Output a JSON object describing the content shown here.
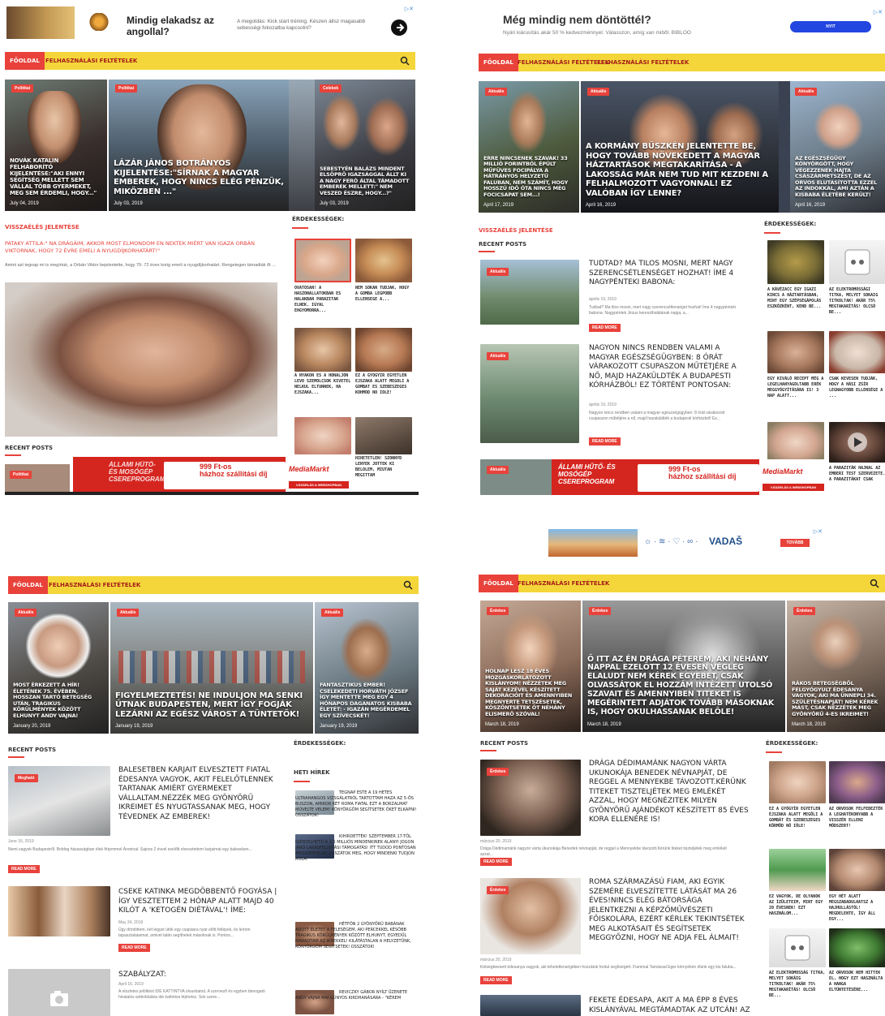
{
  "colors": {
    "accent": "#e8423b",
    "nav": "#f4d63a",
    "nav_link": "#a51a1a"
  },
  "p1": {
    "ad": {
      "title": "Mindig elakadsz az angollal?",
      "desc": "A megoldás: Kick start tréning. Készen állsz magasabb sebességi fokozatba kapcsolni?"
    },
    "nav": {
      "home": "FŐOLDAL",
      "link1": "FELHASZNÁLÁSI FELTÉTELEK"
    },
    "heroes": [
      {
        "badge": "Politikai",
        "title": "Novák Katalin felháborító kijelentése:\"Aki ennyi segítség mellett sem vállal több gyermeket, meg sem érdemli, hogy...\"",
        "date": "July 04, 2019"
      },
      {
        "badge": "Politikai",
        "title": "LÁZÁR JÁNOS BOTRÁNYOS KIJELENTÉSE:\"Sírnak a magyar emberek, hogy nincs elég pénzük, miközben ...\"",
        "date": "July 03, 2019"
      },
      {
        "badge": "Celebek",
        "title": "Sebestyén Balázs mindent elsöprő igazsággal állt ki a nagy Feró által támadott emberek mellett:\" Nem veszed észre, hogy...?\"",
        "date": "July 03, 2019"
      }
    ],
    "section": "VISSZAÉLÉS JELENTÉSE",
    "article": {
      "title": "PATAKY ATTILA:\" NA DRÁGÁIM, AKKOR MOST ELMONDOM EN NEKTEK MIÉRT VAN IGAZA ORBÁN VIKTORNAK, HOGY 72 ÉVRE EMELI A NYUGDÍJKORHATÁRT!\"",
      "excerpt": "Amint azt tegnap mi is megírtuk, a Orbán Viktor bejelentette, hogy 70- 72 éves korig emeli a nyugdíjkorhatárt. Rengetegen támadták őt ..."
    },
    "recent": "RECENT POSTS",
    "recent_badge": "Politikai",
    "side_title": "ÉRDEKESSÉGEK:",
    "side": [
      "OVATOSAN! A HASZONALLATOKBAN ES HALAKBAN PARAZITAK ELNEK. IGYAL EHGYOMORRA...",
      "NEM SOKAN TUDJAK, HOGY A GOMBA LEGPOBB ELLENSEGE A...",
      "A NYAKON ES A HONALJON LEVO SZEMOLCSOK KIVETEL NELKUL ELTUNNEK, HA EJSZAKA...",
      "EZ A GYOGYIR EGYETLEN EJSZAKA ALATT MEGOLI A GOMBAT ES SZEBESZEGES KOHMOD NO IOLE!",
      "",
      "HIHETETLEN! SZONNYD LENYEK JOTTEK KI BELOLEM, MIUTAN MEGITTAM"
    ],
    "banner": {
      "left": "ÁLLAMI HŰTŐ- ÉS MOSÓGÉP CSEREPROGRAM",
      "price": "999 Ft-os",
      "sub": "házhoz szállítási díj",
      "brand": "MediaMarkt",
      "cta": "VÁSÁRLÁS A WEBSHOPBAN"
    }
  },
  "p2": {
    "ad": {
      "title": "Még mindig nem döntöttél?",
      "desc": "Nyári kiárusítás akár 50 % kedvezménnyel. Válasszon, amíg van miből. BIBLOO",
      "btn": "NYIT"
    },
    "nav": {
      "home": "FŐOLDAL",
      "link1": "FELHASZNÁLÁSI FELTÉTELEK",
      "link2": "FELHASZNÁLÁSI FELTÉTELEK"
    },
    "heroes": [
      {
        "badge": "Aktuális",
        "title": "Erre nincsenek szavak! 33 millió forintból épült műfüves focipálya a hátrányos helyzetű faluban, nem számít, hogy hosszú idő óta nincs még focicsapat sem...!",
        "date": "April 17, 2019"
      },
      {
        "badge": "Aktuális",
        "title": "A KORMÁNY BÜSZKÉN JELENTETTE BE, HOGY TOVÁBB NÖVEKEDETT A MAGYAR HÁZTARTÁSOK MEGTAKARÍTÁSA - A LAKOSSÁG MÁR NEM TUD MIT KEZDENI A FELHALMOZOTT VAGYONNAL! EZ VALÓBAN ÍGY LENNE?",
        "date": "April 16, 2019"
      },
      {
        "badge": "Aktuális",
        "title": "Az egészségügy könyörgött, hogy végezzenek hajta császármetszést, de az orvos elutasította ezzel az indokkal, ami aztán a kisbaba életébe került!",
        "date": "April 16, 2019"
      }
    ],
    "section": "VISSZAÉLÉS JELENTÉSE",
    "recent": "RECENT POSTS",
    "posts": [
      {
        "badge": "Aktuális",
        "title": "TUDTAD? MA TILOS MOSNI, MERT NAGY SZERENCSÉTLENSÉGET HOZHAT! ÍME 4 NAGYPÉNTEKI BABONA:",
        "date": "április 19, 2019",
        "excerpt": "Tudtad? Ma tilos mosni, mert nagy szerencsétlenséget hozhat! Íme 4 nagypénteki babona: Nagypéntek Jézus kereszthalálának napja, a...",
        "more": "READ MORE"
      },
      {
        "badge": "Aktuális",
        "title": "NAGYON NINCS RENDBEN VALAMI A MAGYAR EGÉSZSÉGÜGYBEN: 8 ÓRÁT VÁRAKOZOTT CSUPASZON MŰTÉTJÉRE A NŐ, MAJD HAZAKÜLDTÉK A BUDAPESTI KÓRHÁZBÓL! EZ TÖRTÉNT PONTOSAN:",
        "date": "április 19, 2019",
        "excerpt": "Nagyon nincs rendben valami a magyar egészségügyben: 8 órát várakozott csupaszon műtétjére a nő, majd hazaküldték a budapesti kórházból! Ez...",
        "more": "READ MORE"
      }
    ],
    "recent_badge": "Aktuális",
    "side_title": "ÉRDEKESSÉGEK:",
    "side": [
      "A KÁVÉZACC EGY IGAZI KINCS A HÁZTARTÁSBAN, MINT EGY SZÉPSÉGÁPOLÁS ESZKÖZKÉNT, KEND BE...",
      "AZ ELEKTROMOSSÁGI TITKA, MELYET SOKAIG TITKOLTAK! AKÁR 75% MEGTAKARÍTÁS! OLCSÓ BE...",
      "EGY KIVÁLÓ RECEPT MÉG A LEGELHANYAGOLTABB ERÉK MEGGYÓGYÍTÁSÁRA IS! 3 NAP ALATT...",
      "CSAK KEVESEN TUDJÁK, HOGY A HÁSI ZSÍR LEGNAGYOBB ELLENSÉGE A ...",
      "",
      "A PARAZITÁK HAJNAL AZ EMBERI TEST SZERVEZETE. A PARAZITÁKAT CSAK"
    ],
    "banner": {
      "left": "ÁLLAMI HŰTŐ- ÉS MOSÓGÉP CSEREPROGRAM",
      "price": "999 Ft-os",
      "sub": "házhoz szállítási díj",
      "brand": "MediaMarkt",
      "cta": "VÁSÁRLÁS A WEBSHOPBAN"
    }
  },
  "p3": {
    "nav": {
      "home": "FŐOLDAL",
      "link1": "FELHASZNÁLÁSI FELTÉTELEK"
    },
    "heroes": [
      {
        "badge": "Aktuális",
        "title": "Most érkezett a hír! Életének 75. évében, hosszan tartó betegség után, tragikus körülmények között elhunyt Andy Vajna!",
        "date": "January 20, 2019"
      },
      {
        "badge": "Aktuális",
        "title": "FIGYELMEZTETÉS! NE INDULJON MA SENKI ÚTNAK BUDAPESTEN, MERT ÍGY FOGJÁK LEZÁRNI AZ EGÉSZ VÁROST A TÜNTETŐK!",
        "date": "January 19, 2019"
      },
      {
        "badge": "Aktuális",
        "title": "Fantasztikus ember! Cselekedeti Horváth József így mentette meg egy 4 hónapos daganatos kisbaba életét: - Igazán megérdemel egy szívecskét!",
        "date": "January 19, 2019"
      }
    ],
    "recent": "RECENT POSTS",
    "posts": [
      {
        "badge": "Megható",
        "title": "BALESETBEN KARJAIT ELVESZTETT FIATAL ÉDESANYA VAGYOK, AKIT FELELŐTLENNEK TARTANAK AMIÉRT GYERMEKET VÁLLALTAM.NÉZZÉK MEG GYÖNYÖRŰ IKREIMET ÉS NYUGTASSANAK MEG, HOGY TÉVEDNEK AZ EMBEREK!",
        "date": "June 16, 2019",
        "excerpt": "Nemi vagyok Budapestről. Boldog házasságban élek férjemmel Ároninal. Sajnos 2 évvel ezelőtt elvesztettem karjaimat egy baleseben...",
        "more": "READ MORE"
      },
      {
        "badge": "",
        "title": "CSEKE KATINKA MEGDÖBBENTŐ FOGYÁSA | ÍGY VESZTETTEM 2 HÓNAP ALATT MAJD 40 KILÓT A 'KETOGÉN DIÉTÁVAL'! ÍME:",
        "date": "May 24, 2019",
        "excerpt": "Úgy döntöttem, két legyet ütök egy csapásra nyár előtt fellépek, és leírom tapasztalataimat, amivel talán segíthetek másoknak is. Pontos...",
        "more": "READ MORE"
      },
      {
        "badge": "",
        "title": "SZABÁLYZAT:",
        "date": "April 16, 2019",
        "excerpt": "A részletes jelölkést IDE KATTINTVA olvashatod. A szervező és egyben támogató hivatalos weboldalára ide kattintva léphetsz. Sok szere...",
        "more": ""
      }
    ],
    "side_title": "ÉRDEKESSÉGEK:",
    "weekly": "HETI HÍREK",
    "news": [
      "TEGNAP ESTE A 19 HETES ULTRAHANGOS VIZSGÁLATRÓL TARTOTTAM HAZA AZ 5-ÖS BUSZON, AMIKOR KÉT ROMA FIATAL EZT A BORZALMAT MŰVELTE VELEM! KÖNYÖRGÖM SEGÍTSETEK ŐKET ELKAPNI! OSSZÁTOK!",
      "KIHIRDETTÉK! SZEPTEMBER 17-TŐL IGÉNYELHETŐ A 2,5 MILLIÓS MINDENKINEK ALANYI JOGON JÁRÓ LAKÁSFELÚJÍTÁSI TÁMOGATÁS! ITT TUDOD PONTOSAN MEGIGÉNYELNI! OSSZÁTOK MEG, HOGY MINDENKI TUDJON RÓLA!",
      "HÉTFŐN 2 GYÖNYÖRŰ BABÁNAK ADOTT ÉLETET A FELESÉGEM, AKI PERCEKKEL KÉSŐBB TRAGIKUS KÖRÜLMÉNYEK KÖZÖTT ELHUNYT, EGYEDÜL MARADTAM AZ IKREKKEL! KILÁTÁSTALAN A HELYZETÜNK, KÖNYÖRGÖM SEGÍTSETEK! OSSZÁTOK!",
      "REVICZKY GÁBOR NYÍLT ÜZENETE ANDY VAJNA MAI GÚNYOS KIRDHANÁSÁRA - \"KÉREM"
    ]
  },
  "p4": {
    "ad": {
      "brand": "VADAŠ",
      "btn": "TOVÁBB"
    },
    "nav": {
      "home": "FŐOLDAL",
      "link1": "FELHASZNÁLÁSI FELTÉTELEK"
    },
    "heroes": [
      {
        "badge": "Érdekes",
        "title": "Holnap lesz 18 éves mozgáskorlátozott kislányom! Nézzétek meg saját kezével készített dekorációit és amennyiben megnyerte tetszésetek, köszöntsétek őt néhány elismerő szóval!",
        "date": "March 18, 2019"
      },
      {
        "badge": "Érdekes",
        "title": "Ő itt az én drága péterem, aki néhány nappal ezelőtt 12 évesen végleg elaludt nem kérek egyebet, csak olvassátok el hozzám intézett utolsó szavait és amennyiben titeket is megérintett adjátok tovább másoknak is, hogy okulhassanak belőle!",
        "date": "March 18, 2019"
      },
      {
        "badge": "Érdekes",
        "title": "Rákos betegségből felgyógyult édesanya vagyok, aki ma ünnepli 34. születésnapját! Nem kérek mást, csak nézzétek meg gyönyörű 4-es ikreimet!",
        "date": "March 18, 2019"
      }
    ],
    "recent": "RECENT POSTS",
    "posts": [
      {
        "badge": "Érdekes",
        "title": "DRÁGA DÉDIMAMÁNK NAGYON VÁRTA UKUNOKÁJA BENEDEK NÉVNAPJÁT, DE REGGEL A MENNYEKBE TÁVOZOTT.KÉRÜNK TITEKET TISZTELJÉTEK MEG EMLÉKÉT AZZAL, HOGY MEGNÉZITEK MILYEN GYÖNYÖRŰ AJÁNDÉKOT KÉSZÍTETT 85 ÉVES KORA ELLENÉRE IS!",
        "date": "március 20, 2019",
        "excerpt": "Drága Dédimamánk nagyon várta ükunokája Benedek névnapját, de reggel a Mennyekbe távozott.Kérünk titeket tiszteljétek meg emlékét azzal...",
        "more": "READ MORE"
      },
      {
        "badge": "Érdekes",
        "title": "ROMA SZÁRMAZÁSÚ FIAM, AKI EGYIK SZEMÉRE ELVESZÍTETTE LÁTÁSÁT MA 26 ÉVES!NINCS ELÉG BÁTORSÁGA JELENTKEZNI A KÉPZŐMŰVÉSZETI FŐISKOLÁRA, EZÉRT KÉRLEK TEKINTSÉTEK MEG ALKOTÁSAIT ÉS SEGÍTSETEK MEGGYŐZNI, HOGY NE ADJA FEL ÁLMAIT!",
        "date": "március 20, 2019",
        "excerpt": "Kétségbeesett édesanya vagyok, aki tehetetlenségében hozzátok fordul segítségért. Fiammal Tamással Eger környékén élünk egy kis faluba...",
        "more": "READ MORE"
      },
      {
        "badge": "",
        "title": "FEKETE ÉDESAPA, AKIT A MA ÉPP 8 ÉVES KISLÁNYÁVAL MEGTÁMADTAK AZ UTCÁN! AZ",
        "date": "",
        "excerpt": "",
        "more": ""
      }
    ],
    "side_title": "ÉRDEKESSÉGEK:",
    "side": [
      "EZ A GYÓGYÍR EGYETLEN ÉJSZAKA ALATT MEGÖLI A GOMBÁT ÉS SZEBESZEGES KÖRMÖD NŐ IÓLE!",
      "AZ ORVOSOK FELFEDEZTÉK A LEGHATÉKONYABB A VISSZÉR ELLENI MÓDSZERT!",
      "EZ VAGYOK, DE OLYANOK AZ ÍZÜLETEIM, MINT EGY 20 ÉVESNEK! EZT HASZNÁLOM...",
      "EGY HÉT ALATT MEGSZABADULHATSZ A HAJHULLÁSTÓL! MEGDELENTE, ÍGY ÁLL EGY...",
      "AZ ELEKTROMOSSÁG TITKA, MELYET SOKÁIG TITKOLTAK! AKÁR 75% MEGTAKARÍTÁS! OLCSÓ BE...",
      "AZ ORVOSOK NEM HITTEK EL, HOGY EZT HASZNÁLTA A HANGA ELTÜNTETÉSÉRE..."
    ]
  }
}
